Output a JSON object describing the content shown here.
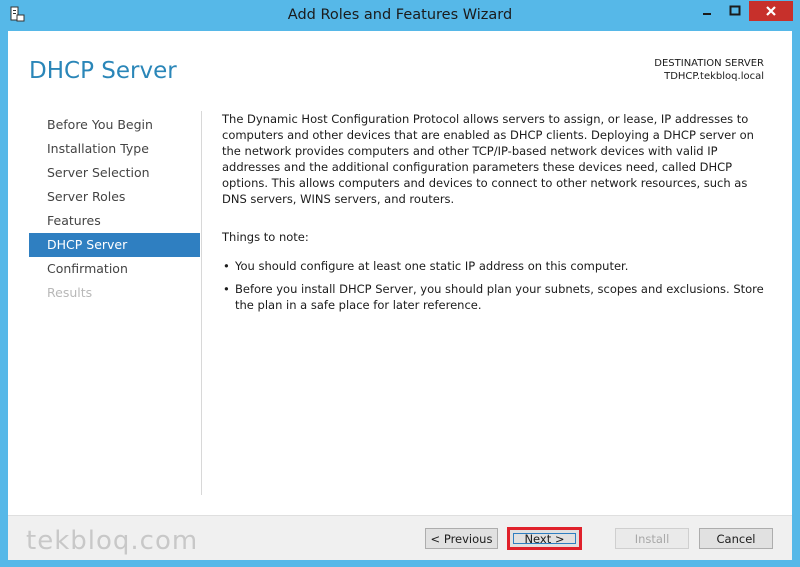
{
  "window": {
    "title": "Add Roles and Features Wizard"
  },
  "header": {
    "page_title": "DHCP Server",
    "destination_label": "DESTINATION SERVER",
    "destination_server": "TDHCP.tekbloq.local"
  },
  "nav": {
    "items": [
      {
        "label": "Before You Begin",
        "state": "normal"
      },
      {
        "label": "Installation Type",
        "state": "normal"
      },
      {
        "label": "Server Selection",
        "state": "normal"
      },
      {
        "label": "Server Roles",
        "state": "normal"
      },
      {
        "label": "Features",
        "state": "normal"
      },
      {
        "label": "DHCP Server",
        "state": "active"
      },
      {
        "label": "Confirmation",
        "state": "normal"
      },
      {
        "label": "Results",
        "state": "disabled"
      }
    ]
  },
  "content": {
    "description": "The Dynamic Host Configuration Protocol allows servers to assign, or lease, IP addresses to computers and other devices that are enabled as DHCP clients. Deploying a DHCP server on the network provides computers and other TCP/IP-based network devices with valid IP addresses and the additional configuration parameters these devices need, called DHCP options. This allows computers and devices to connect to other network resources, such as DNS servers, WINS servers, and routers.",
    "notes_title": "Things to note:",
    "notes": [
      "You should configure at least one static IP address on this computer.",
      "Before you install DHCP Server, you should plan your subnets, scopes and exclusions. Store the plan in a safe place for later reference."
    ]
  },
  "footer": {
    "watermark": "tekbloq.com",
    "previous_label": "< Previous",
    "next_label": "Next >",
    "install_label": "Install",
    "cancel_label": "Cancel"
  },
  "colors": {
    "window_frame": "#56b8e8",
    "accent": "#2f7fc1",
    "title_blue": "#2a86b8",
    "close_red": "#c7302b",
    "highlight_red": "#e0212b"
  }
}
